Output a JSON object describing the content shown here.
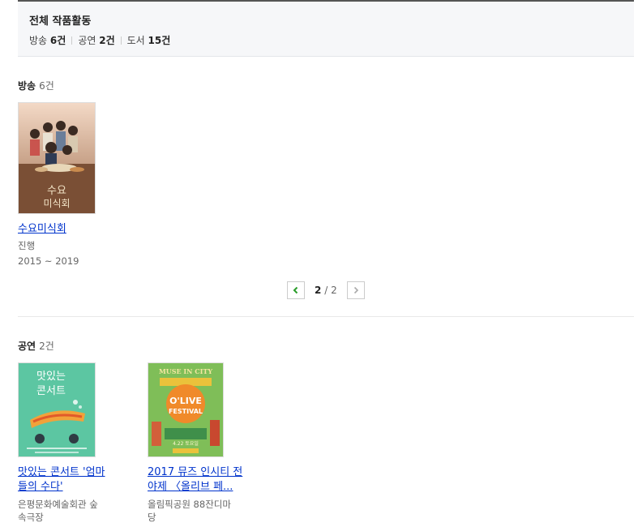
{
  "summary": {
    "title": "전체 작품활동",
    "stats": [
      {
        "label": "방송",
        "count": "6건"
      },
      {
        "label": "공연",
        "count": "2건"
      },
      {
        "label": "도서",
        "count": "15건"
      }
    ]
  },
  "broadcast": {
    "label": "방송",
    "count": "6건",
    "items": [
      {
        "title": "수요미식회",
        "status": "진행",
        "period": "2015 ~ 2019",
        "poster_text": "수요\n미식회"
      }
    ],
    "pager": {
      "current": "2",
      "separator": "/",
      "total": "2"
    }
  },
  "performance": {
    "label": "공연",
    "count": "2건",
    "items": [
      {
        "title_line1": "맛있는 콘서트 '엄마",
        "title_line2": "들의 수다'",
        "venue_line1": "은평문화예술회관 숲",
        "venue_line2": "속극장",
        "poster_text": "맛있는\n콘서트"
      },
      {
        "title_line1": "2017 뮤즈 인시티 전",
        "title_line2": "야제 〈올리브 페...",
        "venue_line1": "올림픽공원 88잔디마",
        "venue_line2": "당",
        "poster_text_top": "MUSE IN CITY",
        "poster_text_main": "O'LIVE",
        "poster_text_sub": "FESTIVAL"
      }
    ]
  },
  "colors": {
    "link": "#0033cc",
    "pager_arrow_active": "#2a9d2a",
    "pager_arrow_inactive": "#aaaaaa"
  }
}
